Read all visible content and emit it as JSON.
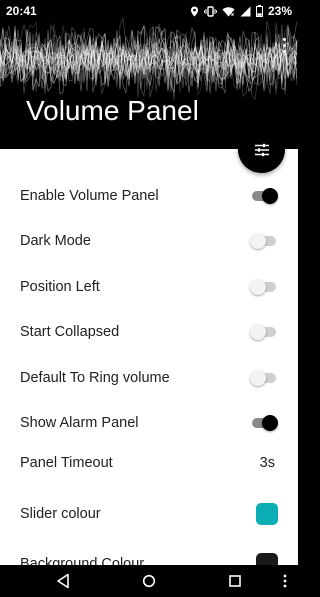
{
  "status": {
    "time": "20:41",
    "battery": "23%",
    "icons": [
      "location-icon",
      "vibrate-icon",
      "wifi-icon",
      "signal-icon",
      "battery-icon"
    ]
  },
  "header": {
    "title": "Volume Panel",
    "background_color": "#000000"
  },
  "settings": [
    {
      "label": "Enable Volume Panel",
      "type": "toggle",
      "on": true
    },
    {
      "label": "Dark Mode",
      "type": "toggle",
      "on": false
    },
    {
      "label": "Position Left",
      "type": "toggle",
      "on": false
    },
    {
      "label": "Start Collapsed",
      "type": "toggle",
      "on": false
    },
    {
      "label": "Default To Ring volume",
      "type": "toggle",
      "on": false
    },
    {
      "label": "Show Alarm Panel",
      "type": "toggle",
      "on": true
    },
    {
      "label": "Panel Timeout",
      "type": "value",
      "value": "3s"
    },
    {
      "label": "Slider colour",
      "type": "color",
      "color": "#0aaeb4"
    },
    {
      "label": "Background Colour",
      "type": "color",
      "color": "#1a1a1a"
    }
  ],
  "colors": {
    "switch_on_thumb": "#000000",
    "switch_off_thumb": "#f3f3f3",
    "content_bg": "#ffffff"
  }
}
